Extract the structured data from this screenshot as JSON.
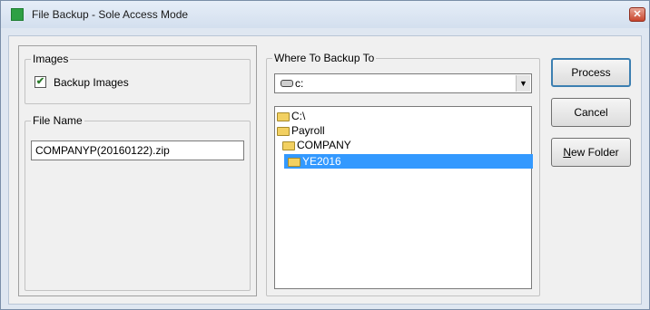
{
  "window": {
    "title": "File Backup - Sole Access Mode",
    "close_glyph": "✕"
  },
  "images_group": {
    "label": "Images",
    "checkbox_label": "Backup Images",
    "checked": true,
    "check_glyph": "✔"
  },
  "file_name_group": {
    "label": "File Name",
    "value": "COMPANYP(20160122).zip"
  },
  "destination_group": {
    "label": "Where To Backup To",
    "drive_value": "c:",
    "drive_icon": "drive-icon",
    "arrow_glyph": "▼",
    "folders": [
      {
        "label": "C:\\",
        "selected": false,
        "icon": "folder-open-icon"
      },
      {
        "label": "Payroll",
        "selected": false,
        "icon": "folder-open-icon"
      },
      {
        "label": "COMPANY",
        "selected": false,
        "icon": "folder-open-icon"
      },
      {
        "label": "YE2016",
        "selected": true,
        "icon": "folder-open-icon"
      }
    ]
  },
  "buttons": {
    "process": "Process",
    "cancel": "Cancel",
    "new_folder_mnemonic": "N",
    "new_folder_rest": "ew Folder"
  },
  "colors": {
    "selection": "#3399ff",
    "app_icon": "#2ea043"
  }
}
